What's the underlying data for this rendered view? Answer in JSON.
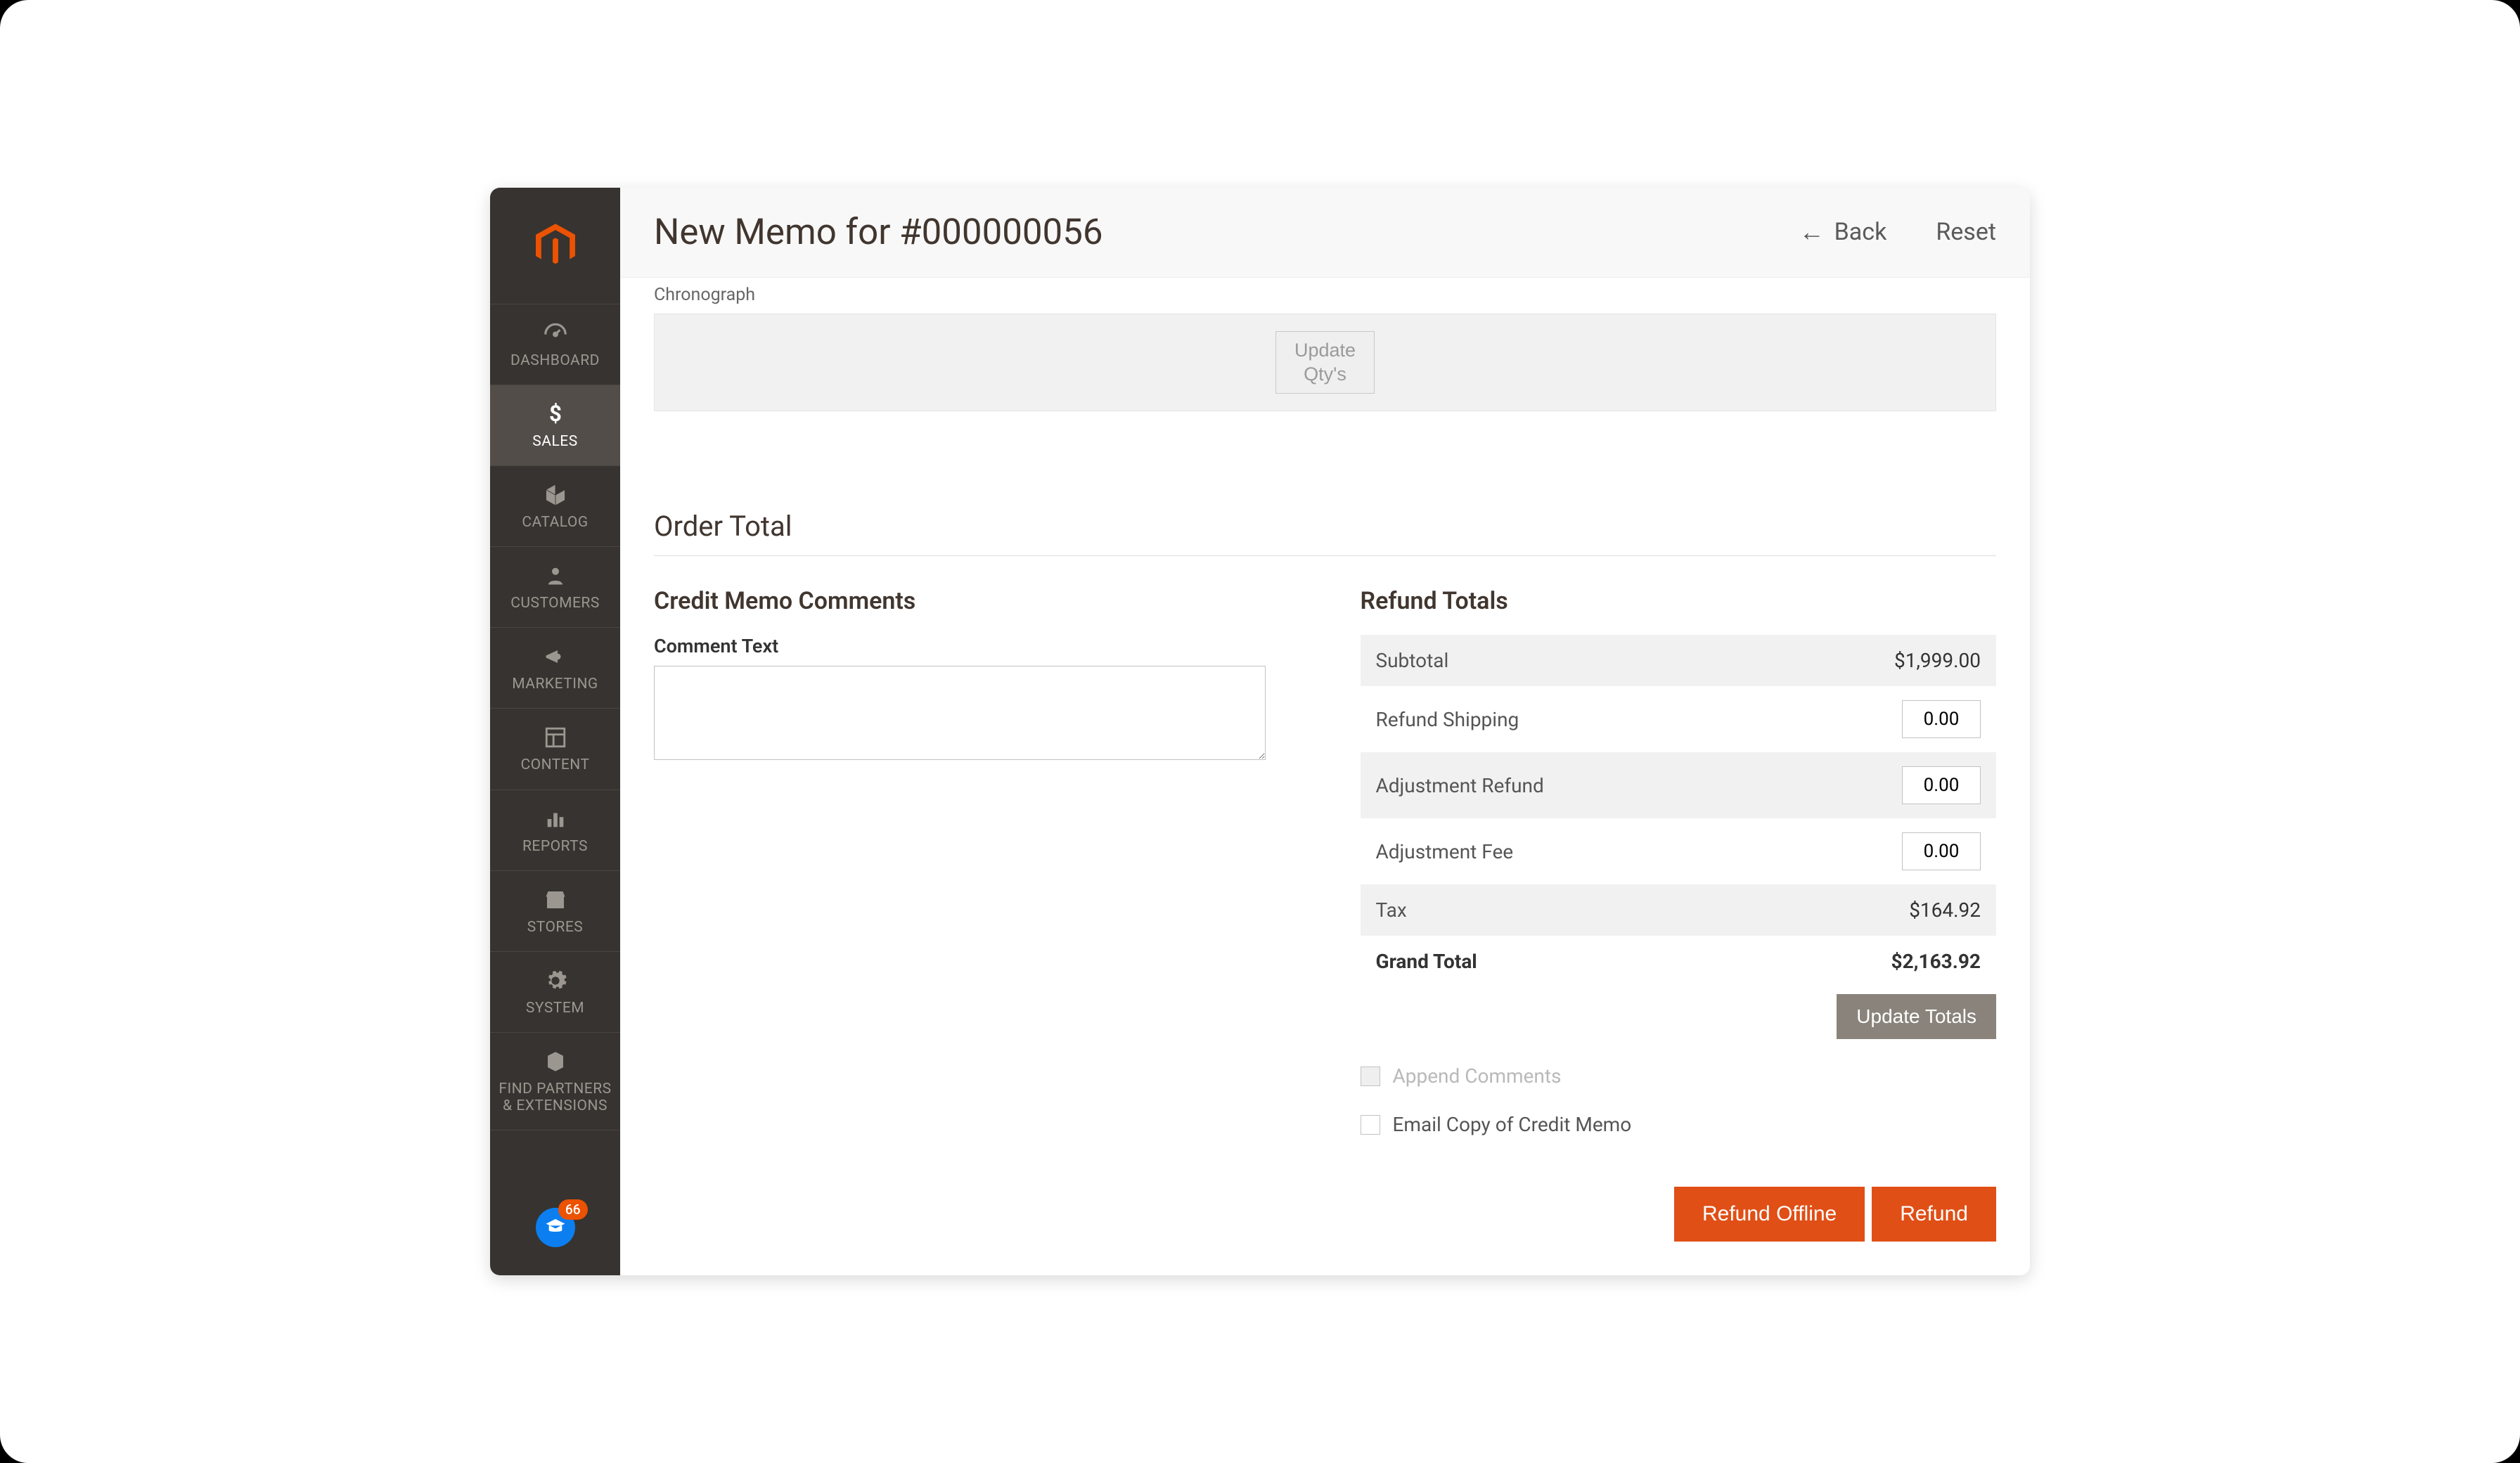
{
  "sidebar": {
    "items": [
      {
        "label": "DASHBOARD"
      },
      {
        "label": "SALES"
      },
      {
        "label": "CATALOG"
      },
      {
        "label": "CUSTOMERS"
      },
      {
        "label": "MARKETING"
      },
      {
        "label": "CONTENT"
      },
      {
        "label": "REPORTS"
      },
      {
        "label": "STORES"
      },
      {
        "label": "SYSTEM"
      },
      {
        "label": "FIND PARTNERS\n& EXTENSIONS"
      }
    ],
    "help_badge": "66"
  },
  "header": {
    "title": "New Memo for #000000056",
    "back_label": "Back",
    "reset_label": "Reset"
  },
  "items_section": {
    "product_line": "Chronograph",
    "update_qty_label": "Update\nQty's"
  },
  "order_total": {
    "section_title": "Order Total",
    "comments_heading": "Credit Memo Comments",
    "comment_label": "Comment Text",
    "comment_value": "",
    "refund_totals_heading": "Refund Totals",
    "rows": {
      "subtotal_label": "Subtotal",
      "subtotal_value": "$1,999.00",
      "refund_shipping_label": "Refund Shipping",
      "refund_shipping_value": "0.00",
      "adjustment_refund_label": "Adjustment Refund",
      "adjustment_refund_value": "0.00",
      "adjustment_fee_label": "Adjustment Fee",
      "adjustment_fee_value": "0.00",
      "tax_label": "Tax",
      "tax_value": "$164.92",
      "grand_total_label": "Grand Total",
      "grand_total_value": "$2,163.92"
    },
    "update_totals_label": "Update Totals",
    "append_comments_label": "Append Comments",
    "email_copy_label": "Email Copy of Credit Memo",
    "refund_offline_label": "Refund Offline",
    "refund_label": "Refund"
  }
}
